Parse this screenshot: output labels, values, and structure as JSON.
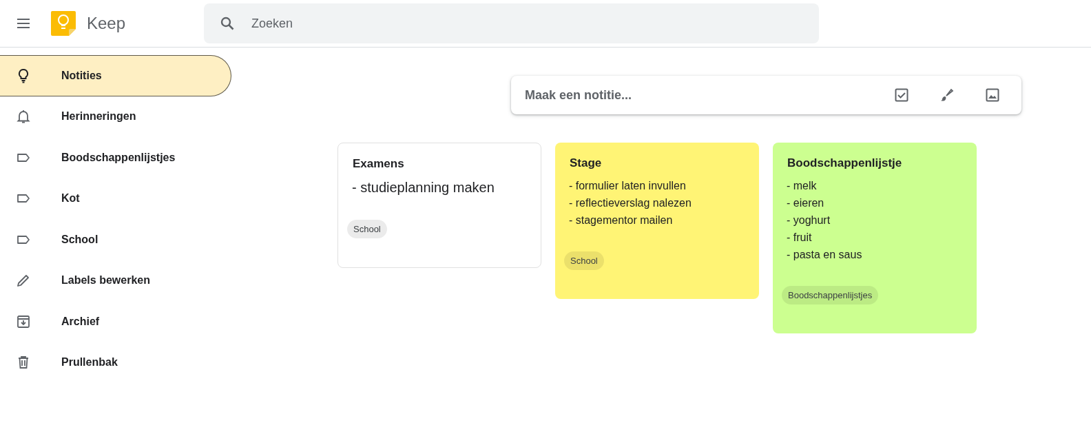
{
  "header": {
    "app_name": "Keep",
    "search": {
      "placeholder": "Zoeken"
    }
  },
  "sidebar": {
    "items": [
      {
        "label": "Notities",
        "kind": "notes",
        "selected": true
      },
      {
        "label": "Herinneringen",
        "kind": "reminders",
        "selected": false
      },
      {
        "label": "Boodschappenlijstjes",
        "kind": "label",
        "selected": false
      },
      {
        "label": "Kot",
        "kind": "label",
        "selected": false
      },
      {
        "label": "School",
        "kind": "label",
        "selected": false
      },
      {
        "label": "Labels bewerken",
        "kind": "edit",
        "selected": false
      },
      {
        "label": "Archief",
        "kind": "archive",
        "selected": false
      },
      {
        "label": "Prullenbak",
        "kind": "trash",
        "selected": false
      }
    ]
  },
  "composer": {
    "placeholder": "Maak een notitie..."
  },
  "notes": [
    {
      "title": "Examens",
      "kind": "short",
      "color": "#ffffff",
      "lines": [
        "- studieplanning maken"
      ],
      "label": "School"
    },
    {
      "title": "Stage",
      "kind": "list",
      "color": "#fff475",
      "lines": [
        "- formulier laten invullen",
        "- reflectieverslag nalezen",
        "- stagementor mailen"
      ],
      "label": "School"
    },
    {
      "title": "Boodschappenlijstje",
      "kind": "list",
      "color": "#ccff90",
      "lines": [
        "- melk",
        "- eieren",
        "- yoghurt",
        "- fruit",
        "- pasta en saus"
      ],
      "label": "Boodschappenlijstjes"
    }
  ]
}
